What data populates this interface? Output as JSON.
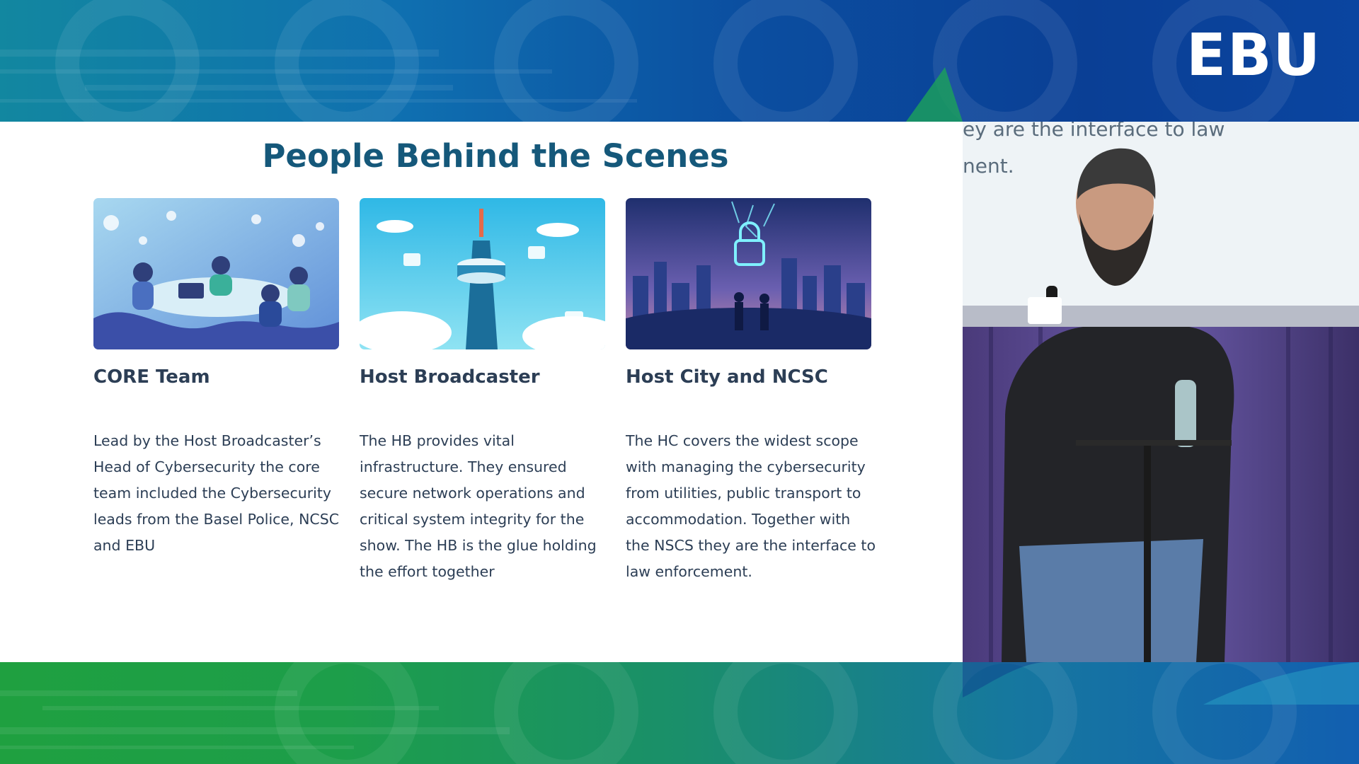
{
  "logo": "EBU",
  "slide": {
    "title": "People Behind the Scenes",
    "cards": [
      {
        "title": "CORE Team",
        "body": "Lead by the Host Broadcaster’s Head of Cybersecurity the core team included the Cybersecurity leads from the Basel Police, NCSC and EBU"
      },
      {
        "title": "Host Broadcaster",
        "body": "The HB provides vital infrastructure. They ensured secure network operations and critical system integrity for the show. The HB is the glue holding the effort together"
      },
      {
        "title": "Host City and NCSC",
        "body": "The HC covers the widest scope with managing the cybersecurity from utilities, public transport to accommodation. Together with the NSCS they are the interface to law enforcement."
      }
    ]
  },
  "camera": {
    "screen_line_1": "ey are the interface to law",
    "screen_line_2": "nent."
  }
}
